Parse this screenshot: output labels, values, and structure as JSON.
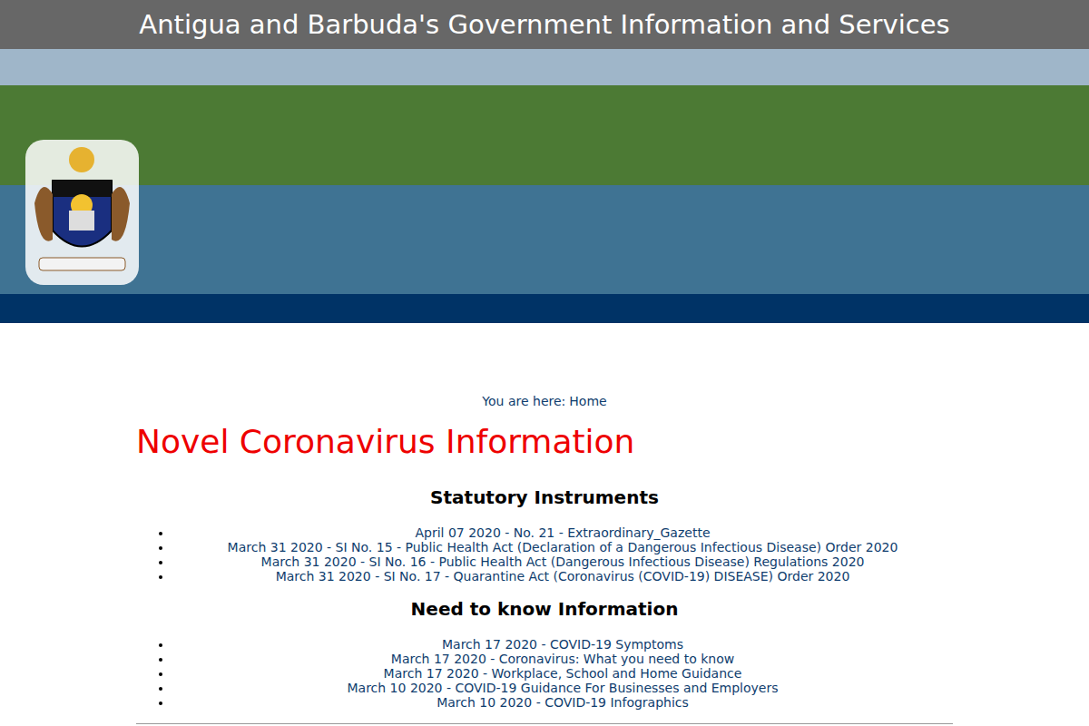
{
  "header": {
    "title": "Antigua and Barbuda's Government Information and Services"
  },
  "breadcrumb": {
    "prefix": "You are here:",
    "current": "Home"
  },
  "page": {
    "title": "Novel Coronavirus Information"
  },
  "sections": [
    {
      "heading": "Statutory Instruments",
      "items": [
        "April 07 2020 - No. 21 - Extraordinary_Gazette",
        "March 31 2020 - SI No. 15 - Public Health Act (Declaration of a Dangerous Infectious Disease) Order 2020",
        "March 31 2020 - SI No. 16 - Public Health Act (Dangerous Infectious Disease) Regulations 2020",
        "March 31 2020 - SI No. 17 - Quarantine Act (Coronavirus (COVID-19) DISEASE) Order 2020"
      ]
    },
    {
      "heading": "Need to know Information",
      "items": [
        "March 17 2020 - COVID-19 Symptoms",
        "March 17 2020 - Coronavirus: What you need to know",
        "March 17 2020 - Workplace, School and Home Guidance",
        "March 10 2020 - COVID-19 Guidance For Businesses and Employers",
        "March 10 2020 - COVID-19 Infographics"
      ]
    }
  ]
}
